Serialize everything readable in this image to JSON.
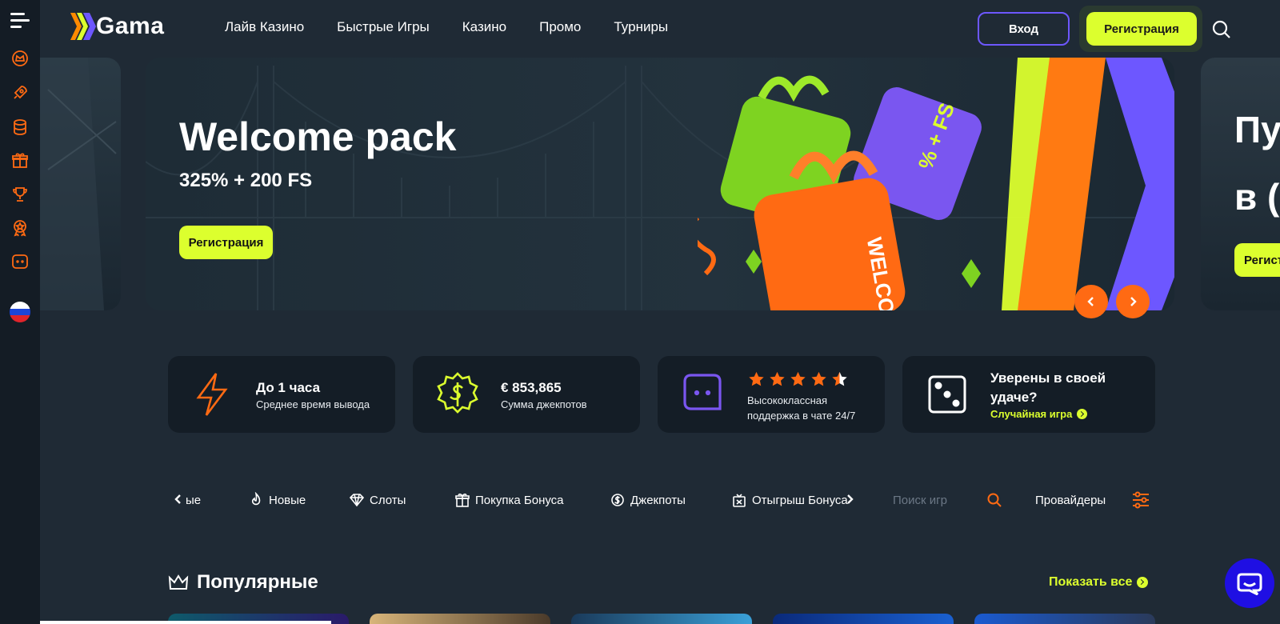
{
  "brand": {
    "name": "Gama",
    "accent": "#dcff2e",
    "purple": "#6d57ff",
    "orange": "#ff6a13"
  },
  "sidebar": {
    "icons": [
      "menu-icon",
      "crown-icon",
      "rocket-icon",
      "coins-icon",
      "gift-icon",
      "trophy-icon",
      "badge-star-icon",
      "chat-icon"
    ],
    "language_flag": "ru-flag-icon"
  },
  "header": {
    "nav": [
      "Лайв Казино",
      "Быстрые Игры",
      "Казино",
      "Промо",
      "Турниры"
    ],
    "login_label": "Вход",
    "register_label": "Регистрация"
  },
  "banner": {
    "title": "Welcome pack",
    "subtitle": "325% + 200 FS",
    "cta_label": "Регистрация",
    "gift_labels": [
      "% + FS",
      "WELCOME"
    ],
    "next_slide_title": "Пу\nв (",
    "next_slide_cta": "Регист"
  },
  "features": [
    {
      "title": "До 1 часа",
      "desc": "Среднее время вывода",
      "icon": "lightning-icon"
    },
    {
      "title": "€  853,865",
      "desc": "Сумма джекпотов",
      "icon": "dollar-badge-icon"
    },
    {
      "rating": 4.5,
      "desc_line1": "Высококлассная",
      "desc_line2": "поддержка в чате 24/7",
      "icon": "chat-face-icon"
    },
    {
      "title_line1": "Уверены в своей",
      "title_line2": "удаче?",
      "link": "Случайная игра",
      "icon": "dice-icon"
    }
  ],
  "categories": {
    "partial_first": "ые",
    "items": [
      {
        "label": "Новые",
        "icon": "flame-icon"
      },
      {
        "label": "Слоты",
        "icon": "diamond-icon"
      },
      {
        "label": "Покупка Бонуса",
        "icon": "gift-icon"
      },
      {
        "label": "Джекпоты",
        "icon": "dollar-gear-icon"
      },
      {
        "label": "Отыгрыш Бонуса",
        "icon": "gift-x-icon"
      }
    ],
    "search_placeholder": "Поиск игр",
    "providers_label": "Провайдеры"
  },
  "popular": {
    "title": "Популярные",
    "show_all": "Показать все"
  }
}
